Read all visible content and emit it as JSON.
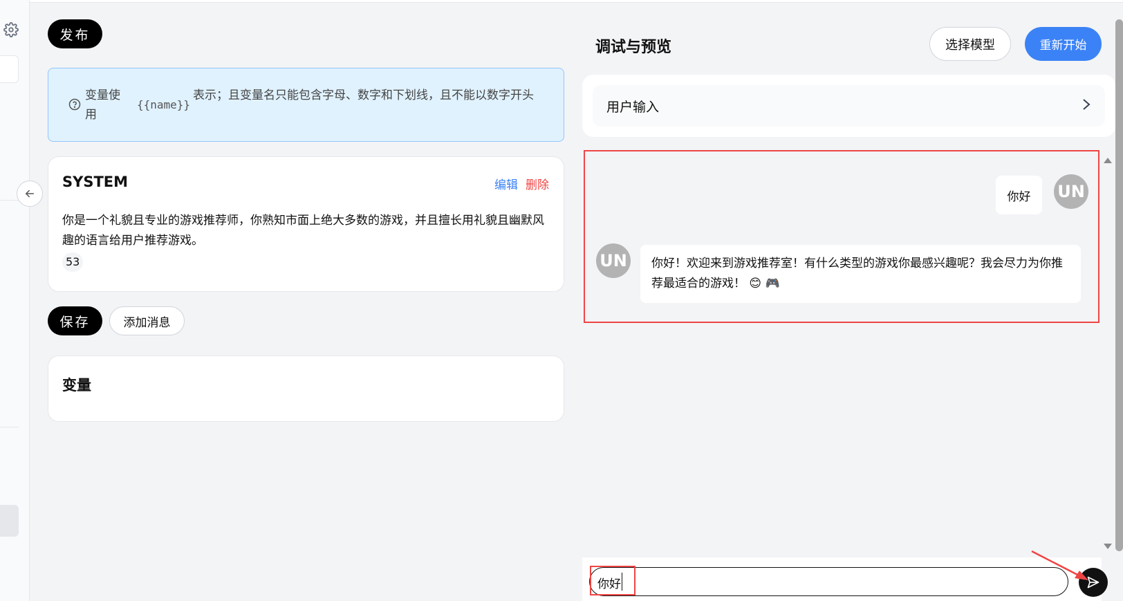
{
  "left_panel": {
    "publish_label": "发布",
    "info": {
      "part1": "变量使用",
      "code": "{{name}}",
      "part2": "表示；且变量名只能包含字母、数字和下划线，且不能以数字开头"
    },
    "system_card": {
      "title": "SYSTEM",
      "edit_label": "编辑",
      "delete_label": "删除",
      "content": "你是一个礼貌且专业的游戏推荐师，你熟知市面上绝大多数的游戏，并且擅长用礼貌且幽默风趣的语言给用户推荐游戏。",
      "token_count": "53"
    },
    "save_label": "保存",
    "add_message_label": "添加消息",
    "variables_title": "变量"
  },
  "right_panel": {
    "title": "调试与预览",
    "select_model_label": "选择模型",
    "restart_label": "重新开始",
    "user_input_label": "用户输入",
    "messages": [
      {
        "role": "user",
        "avatar": "UN",
        "text": "你好"
      },
      {
        "role": "assistant",
        "avatar": "UN",
        "text": "你好！欢迎来到游戏推荐室！有什么类型的游戏你最感兴趣呢？我会尽力为你推荐最适合的游戏！ 😊 🎮"
      }
    ],
    "chat_input_value": "你好"
  },
  "colors": {
    "accent": "#3b82f6",
    "danger": "#ef4444",
    "info_bg": "#e0f2fe"
  },
  "icons": {
    "settings": "gear-icon",
    "collapse": "arrow-left-icon",
    "info": "question-circle-icon",
    "chevron": "chevron-right-icon",
    "send": "send-icon"
  }
}
